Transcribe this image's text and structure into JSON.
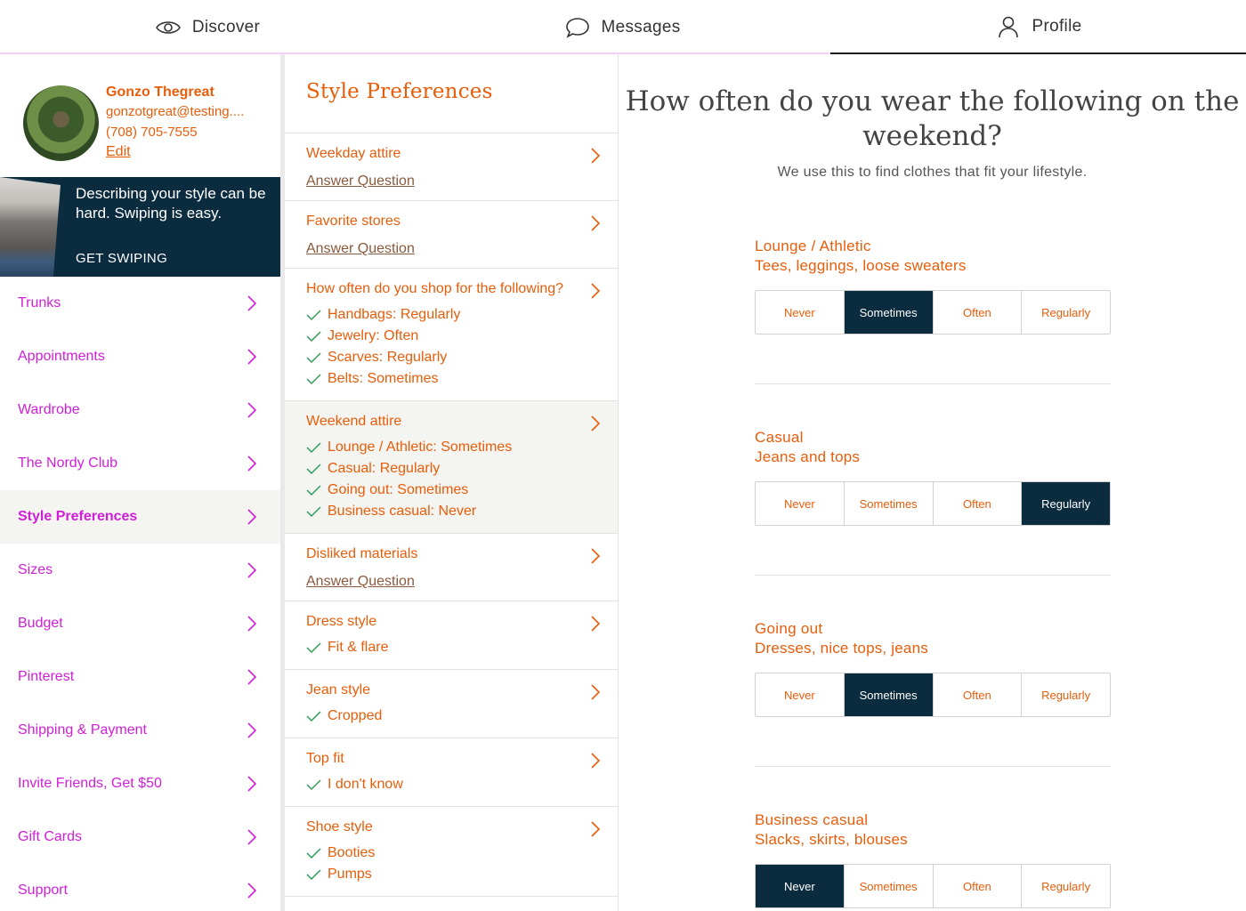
{
  "nav": {
    "tabs": [
      {
        "label": "Discover",
        "icon": "eye-icon"
      },
      {
        "label": "Messages",
        "icon": "chat-bubble-icon"
      },
      {
        "label": "Profile",
        "icon": "user-icon",
        "active": true
      }
    ]
  },
  "profile": {
    "name": "Gonzo Thegreat",
    "email": "gonzotgreat@testing....",
    "phone": "(708) 705-7555",
    "edit_label": "Edit"
  },
  "promo": {
    "text": "Describing your style can be hard. Swiping is easy.",
    "cta": "GET SWIPING"
  },
  "sidebar": {
    "items": [
      {
        "label": "Trunks"
      },
      {
        "label": "Appointments"
      },
      {
        "label": "Wardrobe"
      },
      {
        "label": "The Nordy Club"
      },
      {
        "label": "Style Preferences",
        "active": true
      },
      {
        "label": "Sizes"
      },
      {
        "label": "Budget"
      },
      {
        "label": "Pinterest"
      },
      {
        "label": "Shipping & Payment"
      },
      {
        "label": "Invite Friends, Get $50"
      },
      {
        "label": "Gift Cards"
      },
      {
        "label": "Support"
      }
    ]
  },
  "preferences": {
    "title": "Style Preferences",
    "answer_label": "Answer Question",
    "items": [
      {
        "title": "Weekday attire",
        "answers": []
      },
      {
        "title": "Favorite stores",
        "answers": []
      },
      {
        "title": "How often do you shop for the following?",
        "answers": [
          "Handbags: Regularly",
          "Jewelry: Often",
          "Scarves: Regularly",
          "Belts: Sometimes"
        ]
      },
      {
        "title": "Weekend attire",
        "highlight": true,
        "answers": [
          "Lounge / Athletic: Sometimes",
          "Casual: Regularly",
          "Going out: Sometimes",
          "Business casual: Never"
        ]
      },
      {
        "title": "Disliked materials",
        "answers": []
      },
      {
        "title": "Dress style",
        "answers": [
          "Fit & flare"
        ]
      },
      {
        "title": "Jean style",
        "answers": [
          "Cropped"
        ]
      },
      {
        "title": "Top fit",
        "answers": [
          "I don't know"
        ]
      },
      {
        "title": "Shoe style",
        "answers": [
          "Booties",
          "Pumps"
        ]
      }
    ]
  },
  "question": {
    "title": "How often do you wear the following on the weekend?",
    "subtitle": "We use this to find clothes that fit your lifestyle.",
    "options": [
      "Never",
      "Sometimes",
      "Often",
      "Regularly"
    ],
    "groups": [
      {
        "title": "Lounge / Athletic",
        "desc": "Tees, leggings, loose sweaters",
        "selected": "Sometimes"
      },
      {
        "title": "Casual",
        "desc": "Jeans and tops",
        "selected": "Regularly"
      },
      {
        "title": "Going out",
        "desc": "Dresses, nice tops, jeans",
        "selected": "Sometimes"
      },
      {
        "title": "Business casual",
        "desc": "Slacks, skirts, blouses",
        "selected": "Never"
      }
    ]
  },
  "colors": {
    "accent_orange": "#e85d0a",
    "sidebar_magenta": "#d11ed8",
    "navy": "#0b2b3f",
    "check_green": "#2e9e58"
  }
}
